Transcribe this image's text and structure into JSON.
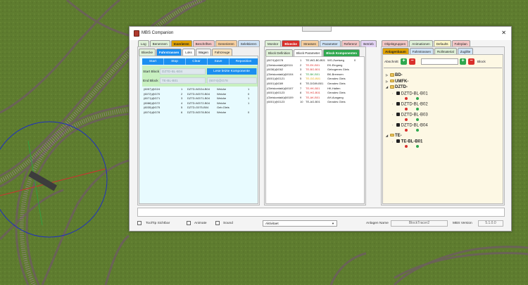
{
  "window": {
    "title": "MBS Companion",
    "close_glyph": "✕"
  },
  "left_panel": {
    "main_tabs": [
      {
        "label": "Log",
        "color": "#dff0d8"
      },
      {
        "label": "Benennen",
        "color": "#dff0d8"
      },
      {
        "label": "Inserieren",
        "color": "#e0a100",
        "active": true
      },
      {
        "label": "Beschriften",
        "color": "#f4c7c7"
      },
      {
        "label": "Generieren",
        "color": "#f6cfa0"
      },
      {
        "label": "Selektieren",
        "color": "#cfe3f6"
      }
    ],
    "sub_tabs": [
      {
        "label": "Bloecke",
        "color": "#dff0d8"
      },
      {
        "label": "Fahrstrassen",
        "color": "#1c8ff0",
        "active": true
      },
      {
        "label": "Loks",
        "color": "#ffffff"
      },
      {
        "label": "Wagen",
        "color": "#f3f3f3"
      },
      {
        "label": "Fahrzeuge",
        "color": "#f9e4c0"
      }
    ],
    "buttons": [
      "Start",
      "Stop",
      "Clear",
      "Save",
      "Reposition"
    ],
    "start_block_label": "Start Block",
    "start_block_value": "DZTD-BL-B04",
    "read_components_button": "Lese letzte Komponente",
    "end_block_label": "End Block",
    "end_block_value": "TE-BL-B01",
    "end_block_value2": "(6074)@G78",
    "rows": [
      {
        "c1": "(6057)@G24",
        "c2": "1",
        "c3": "DZTD-W2/2d-B04",
        "c4": "Weiche",
        "c5": "1"
      },
      {
        "c1": "(6072)@G70",
        "c2": "2",
        "c3": "DZTD-W2/70-B04",
        "c4": "Weiche",
        "c5": "0"
      },
      {
        "c1": "(6071)@G71",
        "c2": "3",
        "c3": "DZTD-W2/71-B04",
        "c4": "Weiche",
        "c5": "1"
      },
      {
        "c1": "(6086)@G72",
        "c2": "4",
        "c3": "DZTD-W2/72-B04",
        "c4": "Weiche",
        "c5": "1"
      },
      {
        "c1": "(6035)@G75",
        "c2": "5",
        "c3": "DZTD-G075-B04",
        "c4": "Geb.Gleis",
        "c5": ""
      },
      {
        "c1": "(6074)@G78",
        "c2": "6",
        "c3": "DZTD-W2/78-B04",
        "c4": "Weiche",
        "c5": "0"
      }
    ]
  },
  "middle_panel": {
    "main_tabs": [
      {
        "label": "Monitor",
        "color": "#dff0d8"
      },
      {
        "label": "Bloecke",
        "color": "#d9302c",
        "active": true
      },
      {
        "label": "Strassen",
        "color": "#f6cfa0"
      },
      {
        "label": "Parameter",
        "color": "#cfe3f6"
      },
      {
        "label": "Referenz",
        "color": "#f4c7c7"
      },
      {
        "label": "Betrieb",
        "color": "#e4d4f4"
      }
    ],
    "sub_tabs": [
      {
        "label": "Block Definition",
        "color": "#dff0d8"
      },
      {
        "label": "Block Parameter",
        "color": "#ffffff"
      },
      {
        "label": "Block Komponenten",
        "color": "#2fa84f",
        "active": true
      }
    ],
    "rows": [
      {
        "c1": "(6074)@G78",
        "c2": "1",
        "c3": "TE-WG-B0-B01",
        "c4": "WG-Zweiweg",
        "c5": "0"
      },
      {
        "c1": "(Gleiskontakt)@0111",
        "c2": "2",
        "c3": "TE-EK-B01",
        "c4": "EK-Eingang",
        "c5": ""
      },
      {
        "c1": "(6036)@G62",
        "c2": "3",
        "c3": "TE-BG-B01",
        "c4": "Gebogenes Gleis",
        "c5": ""
      },
      {
        "c1": "(Gleiskontakt)@0104",
        "c2": "4",
        "c3": "TE-BK-B01",
        "c4": "BK-Bremsen",
        "c5": ""
      },
      {
        "c1": "(6001)@G121",
        "c2": "5",
        "c3": "TE-GG-B01",
        "c4": "Gerades Gleis",
        "c5": ""
      },
      {
        "c1": "(6001)@G89",
        "c2": "6",
        "c3": "TE-DG89-B01",
        "c4": "Gerades Gleis",
        "c5": ""
      },
      {
        "c1": "(Gleiskontakt)@0107",
        "c2": "7",
        "c3": "TE-HK-B01",
        "c4": "HK-Halten",
        "c5": ""
      },
      {
        "c1": "(6001)@G123",
        "c2": "8",
        "c3": "TE-HG-B01",
        "c4": "Gerades Gleis",
        "c5": ""
      },
      {
        "c1": "(Gleiskontakt)@0109",
        "c2": "9",
        "c3": "TE-AK-B01",
        "c4": "AH-Ausgang",
        "c5": ""
      },
      {
        "c1": "(6001)@G123",
        "c2": "10",
        "c3": "TE-AG-B01",
        "c4": "Gerades Gleis",
        "c5": ""
      }
    ],
    "c3_colors": [
      "#222222",
      "#d9302c",
      "#d9302c",
      "#2a9a3a",
      "#e0a100",
      "#222222",
      "#d9302c",
      "#d9302c",
      "#d9302c",
      "#222222"
    ]
  },
  "right_panel": {
    "main_tabs": [
      {
        "label": "Objektgruppen",
        "color": "#f4c7c7"
      },
      {
        "label": "Animationen",
        "color": "#dff0d8"
      },
      {
        "label": "Defaults",
        "color": "#fbf5c8"
      },
      {
        "label": "Fahrplan",
        "color": "#f4c7c7"
      }
    ],
    "sub_tabs": [
      {
        "label": "Anlagenbaum",
        "color": "#e0a100",
        "active": true
      },
      {
        "label": "Fahrstrassen",
        "color": "#cfe3f6"
      },
      {
        "label": "Rollmaterial",
        "color": "#dff0d8"
      },
      {
        "label": "Zuglilte",
        "color": "#cfe3f6"
      }
    ],
    "abschnitt_label": "Abschnitt",
    "block_label": "Block",
    "tree": [
      {
        "label": "BD-",
        "expanded": false
      },
      {
        "label": "UMFK-",
        "expanded": false
      },
      {
        "label": "DZTD-",
        "expanded": true,
        "children": [
          "DZTD-BL-B01",
          "DZTD-BL-B02",
          "DZTD-BL-B03",
          "DZTD-BL-B04"
        ]
      },
      {
        "label": "TE-",
        "expanded": true,
        "children": [
          "TE-BL-B01"
        ]
      }
    ]
  },
  "bottom": {
    "tooltip_label": "ToolTip Sichtbar",
    "animate_label": "Animate",
    "sound_label": "Sound",
    "activity_value": "Aktivitaet",
    "anlagen_name_label": "Anlagen Name",
    "anlagen_name_value": "BlockTracer2",
    "mbs_version_label": "MBS Version",
    "mbs_version_value": "5.1.0.0"
  },
  "colors": {
    "accent_blue": "#1c8ff0",
    "grass": "#5f7d30",
    "red": "#d9302c",
    "green": "#2fa84f"
  }
}
